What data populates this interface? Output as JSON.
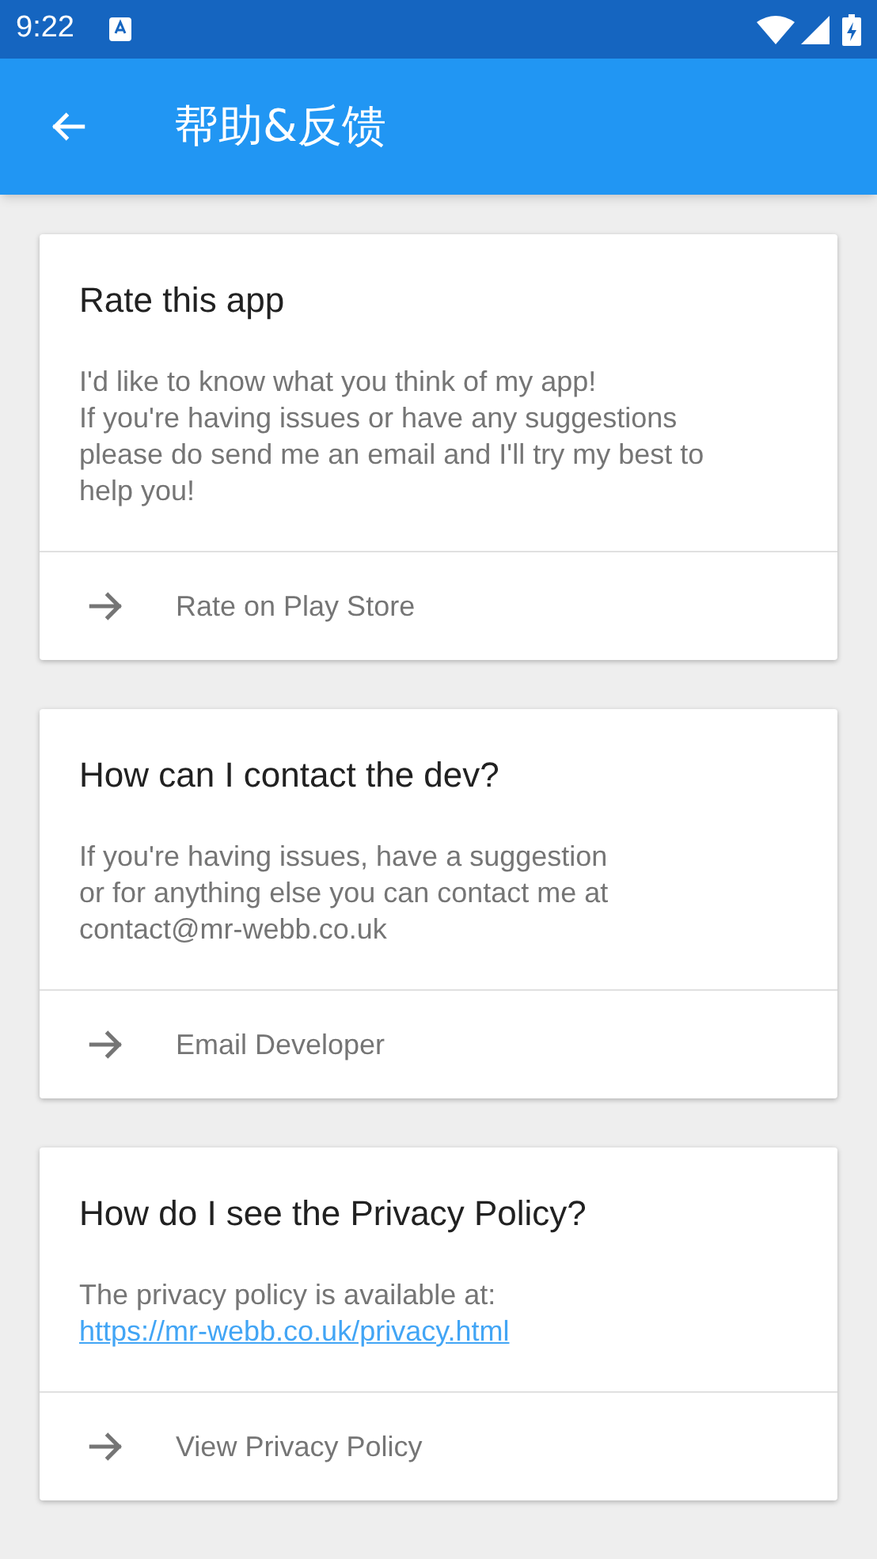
{
  "status_bar": {
    "time": "9:22"
  },
  "app_bar": {
    "title": "帮助&反馈"
  },
  "cards": [
    {
      "title": "Rate this app",
      "body_lines": [
        "I'd like to know what you think of my app!",
        "If you're having issues or have any suggestions please do send me an email and I'll try my best to help you!"
      ],
      "action": "Rate on Play Store"
    },
    {
      "title": "How can I contact the dev?",
      "body_lines": [
        "If you're having issues, have a suggestion",
        "or for anything else you can contact me at",
        "contact@mr-webb.co.uk"
      ],
      "action": "Email Developer"
    },
    {
      "title": "How do I see the Privacy Policy?",
      "body_lines": [
        "The privacy policy is available at:"
      ],
      "link": "https://mr-webb.co.uk/privacy.html",
      "action": "View Privacy Policy"
    }
  ]
}
